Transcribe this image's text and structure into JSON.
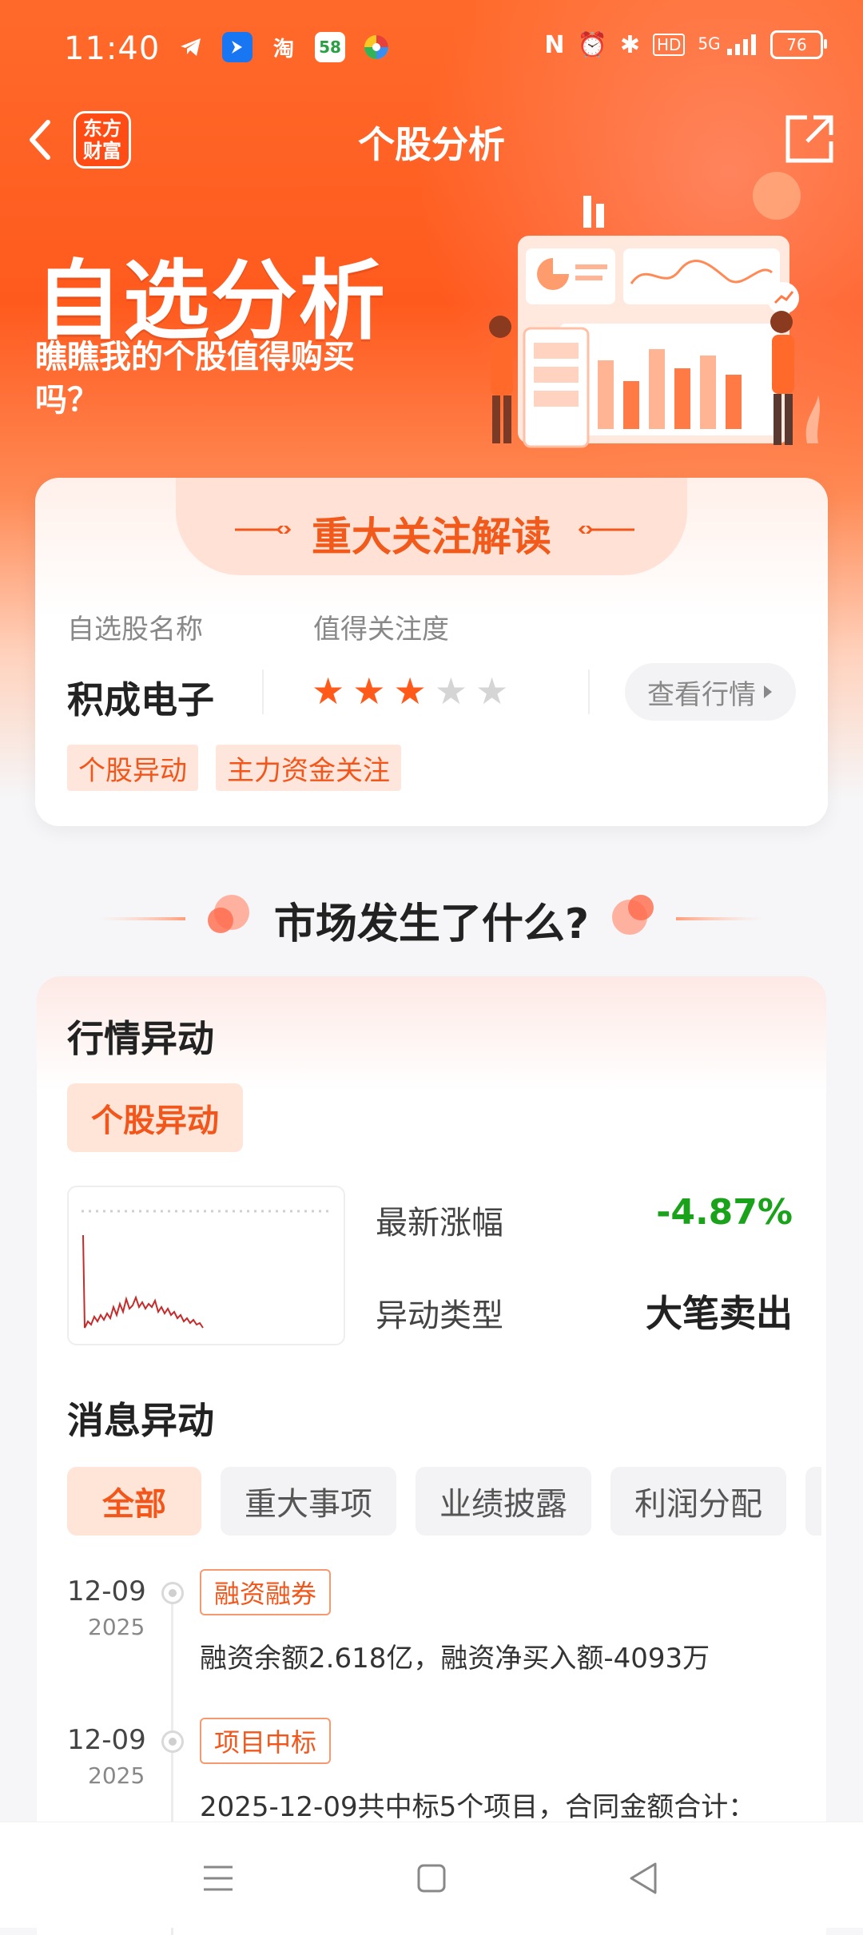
{
  "status_bar": {
    "time": "11:40",
    "app_icons": [
      "telegram-icon",
      "feishu-icon",
      "taobao-icon",
      "58-icon",
      "colorful-app-icon"
    ],
    "taobao_label": "淘",
    "app58_label": "58",
    "battery": "76",
    "network": "5G"
  },
  "nav": {
    "title": "个股分析",
    "logo_line1": "东方",
    "logo_line2": "财富"
  },
  "banner": {
    "title": "自选分析",
    "subtitle": "瞧瞧我的个股值得购买吗？"
  },
  "focus_card": {
    "title": "重大关注解读",
    "label_name": "自选股名称",
    "label_attention": "值得关注度",
    "stock_name": "积成电子",
    "rating": 3,
    "rating_max": 5,
    "view_button": "查看行情",
    "tags": [
      "个股异动",
      "主力资金关注"
    ]
  },
  "section": {
    "title": "市场发生了什么?"
  },
  "market_card": {
    "heading_quote": "行情异动",
    "pill": "个股异动",
    "latest_change_label": "最新涨幅",
    "latest_change_value": "-4.87%",
    "type_label": "异动类型",
    "type_value": "大笔卖出",
    "heading_news": "消息异动",
    "filters": [
      "全部",
      "重大事项",
      "业绩披露",
      "利润分配"
    ],
    "news": [
      {
        "date": "12-09",
        "year": "2025",
        "tag": "融资融券",
        "text": "融资余额2.618亿，融资净买入额-4093万"
      },
      {
        "date": "12-09",
        "year": "2025",
        "tag": "项目中标",
        "text": "2025-12-09共中标5个项目，合同金额合计："
      }
    ]
  },
  "colors": {
    "accent": "#f2561a",
    "up_down_green": "#1aa31a"
  }
}
